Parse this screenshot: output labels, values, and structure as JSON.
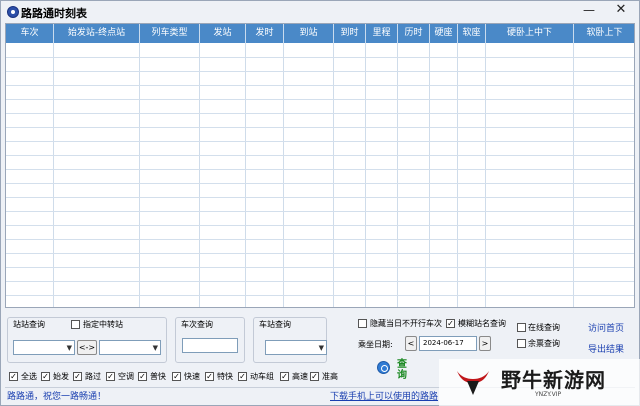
{
  "window": {
    "title": "路路通时刻表",
    "minimize": "—",
    "close": "✕"
  },
  "grid": {
    "columns": [
      "车次",
      "始发站-终点站",
      "列车类型",
      "发站",
      "发时",
      "到站",
      "到时",
      "里程",
      "历时",
      "硬座",
      "软座",
      "硬卧上中下",
      "软卧上下"
    ]
  },
  "panel": {
    "station_query_label": "站站查询",
    "transfer_label": "指定中转站",
    "from_station_value": "",
    "to_station_value": "",
    "swap_label": "<->",
    "train_query_label": "车次查询",
    "train_no_value": "",
    "station_search_label": "车站查询",
    "station_value": "",
    "hide_label": "隐藏当日不开行车次",
    "fuzzy_label": "模糊站名查询",
    "date_label": "乘坐日期:",
    "date_value": "2024-06-17",
    "prev_label": "<",
    "next_label": ">",
    "online_label": "在线查询",
    "remaining_label": "余票查询",
    "home_link": "访问首页",
    "export_link": "导出结果",
    "query_label": "查询",
    "filters": [
      {
        "label": "全选",
        "checked": true
      },
      {
        "label": "始发",
        "checked": true
      },
      {
        "label": "路过",
        "checked": true
      },
      {
        "label": "空调",
        "checked": true
      },
      {
        "label": "普快",
        "checked": true
      },
      {
        "label": "快速",
        "checked": true
      },
      {
        "label": "特快",
        "checked": true
      },
      {
        "label": "动车组",
        "checked": true
      },
      {
        "label": "高速",
        "checked": true
      },
      {
        "label": "准高",
        "checked": true
      }
    ]
  },
  "status": {
    "left": "路路通，祝您一路畅通！",
    "right": "下载手机上可以使用的路路"
  },
  "watermark": {
    "text": "野牛新游网",
    "sub": "YNZY.VIP"
  }
}
